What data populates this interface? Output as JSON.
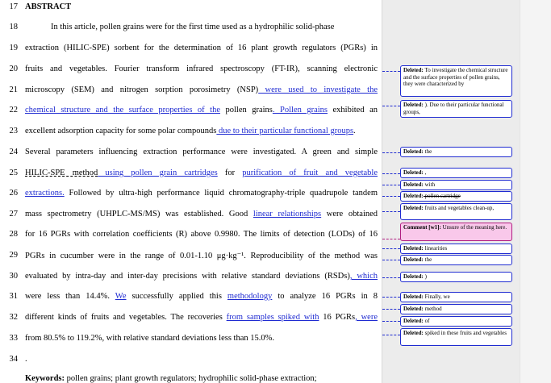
{
  "line_numbers": [
    "17",
    "18",
    "19",
    "20",
    "21",
    "22",
    "23",
    "24",
    "25",
    "26",
    "27",
    "28",
    "29",
    "30",
    "31",
    "32",
    "33",
    "34"
  ],
  "heading": "ABSTRACT",
  "lines": {
    "l18": "In this article, pollen grains were for the first time used as a hydrophilic solid-phase",
    "l19": "extraction (HILIC-SPE) sorbent for the determination of 16 plant growth regulators (PGRs) in",
    "l20": "fruits and vegetables. Fourier transform infrared spectroscopy (FT-IR), scanning electronic",
    "l21a": "microscopy (SEM) and nitrogen sorption porosimetry (NSP)",
    "l21b": " were used to investigate the",
    "l22a": "chemical structure and the surface properties of the",
    "l22b": " pollen grains",
    "l22c": ". Pollen grains",
    "l22d": " exhibited an",
    "l23a": "excellent adsorption capacity for some polar compounds",
    "l23b": " due to their particular functional groups",
    "l23c": ".",
    "l24": "Several parameters influencing extraction performance were investigated. A green and simple",
    "l25a": "HILIC-SPE method",
    "l25b": " using pollen grain cartridges",
    "l25c": " for ",
    "l25d": "purification of fruit and vegetable",
    "l26a": "extractions.",
    "l26b": " Followed by ultra-high performance liquid chromatography-triple quadrupole tandem",
    "l27a": "mass spectrometry (UHPLC-MS/MS) was established. Good ",
    "l27b": "linear relationships",
    "l27c": " were obtained",
    "l28": "for 16 PGRs with correlation coefficients (R) above 0.9980. The limits of detection (LODs) of 16",
    "l29": "PGRs in cucumber were in the range of 0.01-1.10 μg·kg⁻¹. Reproducibility of the method was",
    "l30a": "evaluated by intra-day and inter-day precisions with relative standard deviations (RSDs)",
    "l30b": ", which",
    "l31a": "were less than 14.4%. ",
    "l31b": "We",
    "l31c": " successfully applied this ",
    "l31d": "methodology",
    "l31e": " to analyze 16 PGRs in 8",
    "l32": "different kinds of fruits and vegetables. The recoveries ",
    "l32b": "from samples spiked with",
    "l32c": " 16 PGRs",
    "l32d": ", were",
    "l33": "from 80.5% to 119.2%, with relative standard deviations less than 15.0%.",
    "l34": ".",
    "keywords_label": "Keywords:",
    "keywords": " pollen grains; plant growth regulators; hydrophilic solid-phase extraction;"
  },
  "balloons": [
    {
      "label": "Deleted:",
      "text": " To investigate the chemical structure and the surface properties of pollen grains, they were characterized by"
    },
    {
      "label": "Deleted:",
      "text": " ). Due to their particular functional groups,"
    },
    {
      "label": "Deleted:",
      "text": " the"
    },
    {
      "label": "Deleted:",
      "text": " ,"
    },
    {
      "label": "Deleted:",
      "text": " with"
    },
    {
      "label": "Deleted:",
      "text": " pollen cartridge"
    },
    {
      "label": "Deleted:",
      "text": " fruits and vegetables clean-up,"
    },
    {
      "label": "Comment [w1]:",
      "text": " Unsure of the meaning here."
    },
    {
      "label": "Deleted:",
      "text": " linearities"
    },
    {
      "label": "Deleted:",
      "text": " the"
    },
    {
      "label": "Deleted:",
      "text": " )"
    },
    {
      "label": "Deleted:",
      "text": " Finally, we"
    },
    {
      "label": "Deleted:",
      "text": " method"
    },
    {
      "label": "Deleted:",
      "text": " of"
    },
    {
      "label": "Deleted:",
      "text": " spiked in these fruits and vegetables"
    }
  ],
  "colors": {
    "insertion": "#1f2bd1",
    "comment_fill": "#f9c8ea",
    "comment_border": "#b01c80",
    "margin_pane": "#ececec"
  }
}
